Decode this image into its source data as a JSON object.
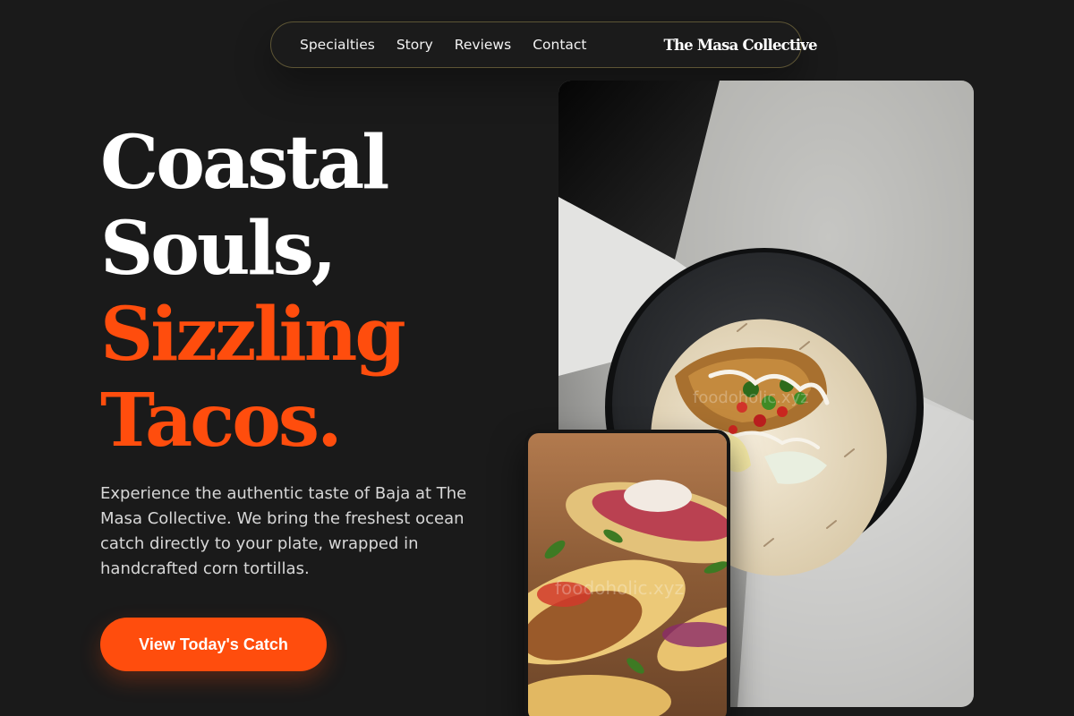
{
  "nav": {
    "links": [
      "Specialties",
      "Story",
      "Reviews",
      "Contact"
    ],
    "brand": "The Masa Collective"
  },
  "hero": {
    "headline_white": [
      "Coastal",
      "Souls,"
    ],
    "headline_accent": [
      "Sizzling",
      "Tacos."
    ],
    "description": "Experience the authentic taste of Baja at The Masa Collective. We bring the freshest ocean catch directly to your plate, wrapped in handcrafted corn tortillas.",
    "cta_label": "View Today's Catch"
  },
  "images": {
    "large_watermark": "foodoholic.xyz",
    "small_watermark": "foodoholic.xyz"
  },
  "colors": {
    "background": "#1a1a1a",
    "accent": "#ff4d0d",
    "nav_border": "#5d5535"
  }
}
